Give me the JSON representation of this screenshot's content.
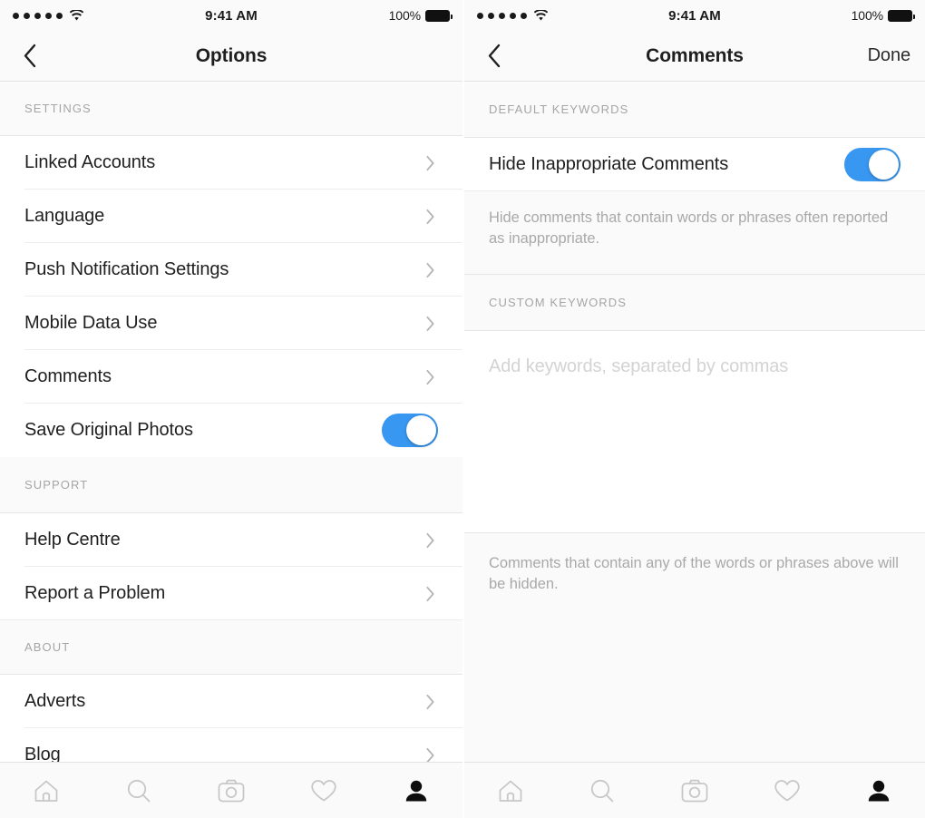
{
  "status_bar": {
    "signal_dots": 5,
    "wifi_icon": "wifi-icon",
    "time": "9:41 AM",
    "battery_percent": "100%",
    "battery_icon": "battery-full-icon"
  },
  "left_screen": {
    "nav": {
      "back_icon": "chevron-left-icon",
      "title": "Options"
    },
    "sections": [
      {
        "header": "SETTINGS",
        "rows": [
          {
            "label": "Linked Accounts",
            "accessory": "chevron-right-icon"
          },
          {
            "label": "Language",
            "accessory": "chevron-right-icon"
          },
          {
            "label": "Push Notification Settings",
            "accessory": "chevron-right-icon"
          },
          {
            "label": "Mobile Data Use",
            "accessory": "chevron-right-icon"
          },
          {
            "label": "Comments",
            "accessory": "chevron-right-icon"
          },
          {
            "label": "Save Original Photos",
            "accessory": "toggle",
            "toggle_on": true
          }
        ]
      },
      {
        "header": "SUPPORT",
        "rows": [
          {
            "label": "Help Centre",
            "accessory": "chevron-right-icon"
          },
          {
            "label": "Report a Problem",
            "accessory": "chevron-right-icon"
          }
        ]
      },
      {
        "header": "ABOUT",
        "rows": [
          {
            "label": "Adverts",
            "accessory": "chevron-right-icon"
          },
          {
            "label": "Blog",
            "accessory": "chevron-right-icon"
          }
        ]
      }
    ]
  },
  "right_screen": {
    "nav": {
      "back_icon": "chevron-left-icon",
      "title": "Comments",
      "action": "Done"
    },
    "default_keywords": {
      "header": "DEFAULT KEYWORDS",
      "row_label": "Hide Inappropriate Comments",
      "toggle_on": true,
      "description": "Hide comments that contain words or phrases often reported as inappropriate."
    },
    "custom_keywords": {
      "header": "CUSTOM KEYWORDS",
      "input_value": "",
      "input_placeholder": "Add keywords, separated by commas",
      "footnote": "Comments that contain any of the words or phrases above will be hidden."
    }
  },
  "tab_bar": {
    "items": [
      {
        "icon": "home-icon",
        "active": false
      },
      {
        "icon": "search-icon",
        "active": false
      },
      {
        "icon": "camera-icon",
        "active": false
      },
      {
        "icon": "heart-icon",
        "active": false
      },
      {
        "icon": "profile-icon",
        "active": true
      }
    ]
  },
  "colors": {
    "accent": "#3897f0",
    "background": "#ffffff",
    "chrome": "#fafafa",
    "separator": "#ededed",
    "text_primary": "#1f1f1f",
    "text_muted": "#a9a9a9",
    "placeholder": "#d3d3d3",
    "icon_inactive": "#c7c7c7",
    "icon_active": "#0d0d0d"
  }
}
